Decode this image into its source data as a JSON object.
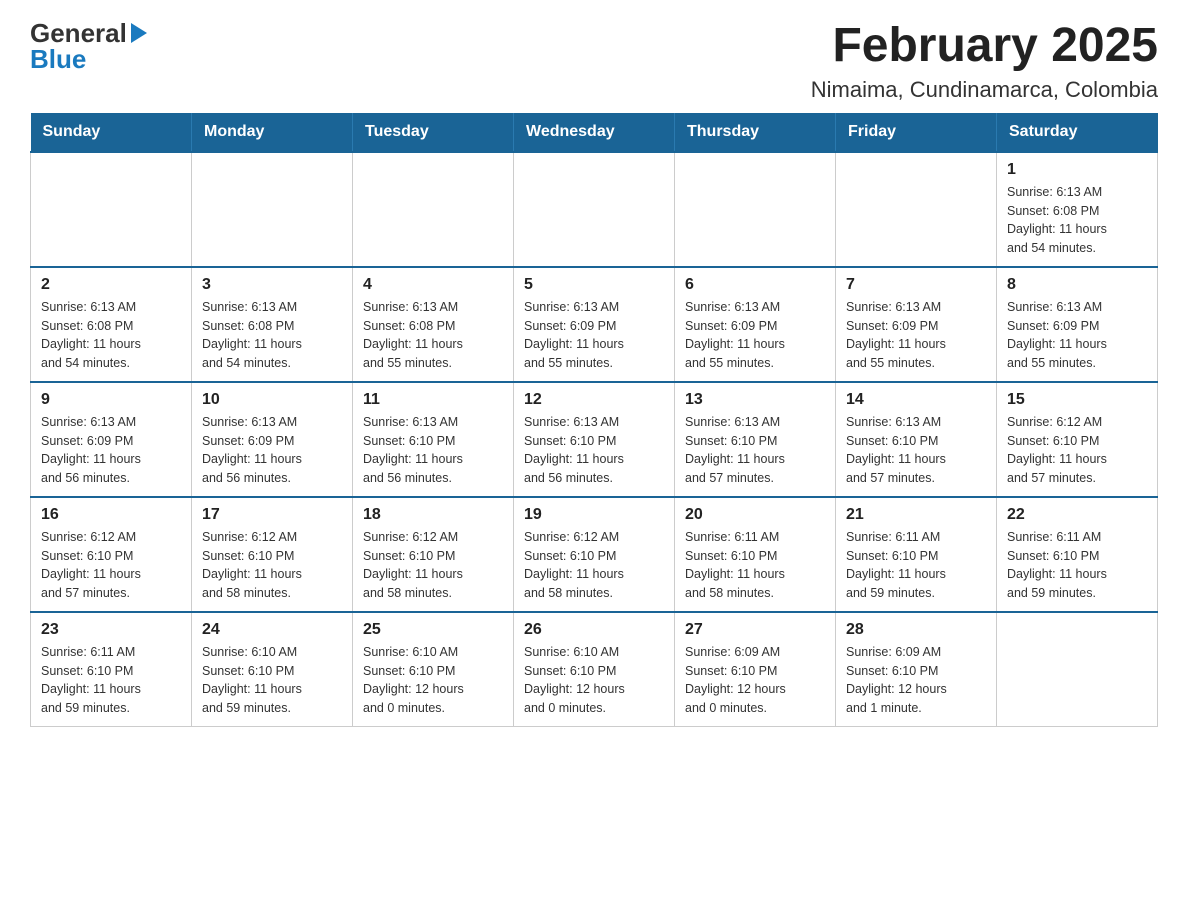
{
  "header": {
    "logo_general": "General",
    "logo_blue": "Blue",
    "title": "February 2025",
    "subtitle": "Nimaima, Cundinamarca, Colombia"
  },
  "weekdays": [
    "Sunday",
    "Monday",
    "Tuesday",
    "Wednesday",
    "Thursday",
    "Friday",
    "Saturday"
  ],
  "weeks": [
    [
      {
        "day": "",
        "info": ""
      },
      {
        "day": "",
        "info": ""
      },
      {
        "day": "",
        "info": ""
      },
      {
        "day": "",
        "info": ""
      },
      {
        "day": "",
        "info": ""
      },
      {
        "day": "",
        "info": ""
      },
      {
        "day": "1",
        "info": "Sunrise: 6:13 AM\nSunset: 6:08 PM\nDaylight: 11 hours\nand 54 minutes."
      }
    ],
    [
      {
        "day": "2",
        "info": "Sunrise: 6:13 AM\nSunset: 6:08 PM\nDaylight: 11 hours\nand 54 minutes."
      },
      {
        "day": "3",
        "info": "Sunrise: 6:13 AM\nSunset: 6:08 PM\nDaylight: 11 hours\nand 54 minutes."
      },
      {
        "day": "4",
        "info": "Sunrise: 6:13 AM\nSunset: 6:08 PM\nDaylight: 11 hours\nand 55 minutes."
      },
      {
        "day": "5",
        "info": "Sunrise: 6:13 AM\nSunset: 6:09 PM\nDaylight: 11 hours\nand 55 minutes."
      },
      {
        "day": "6",
        "info": "Sunrise: 6:13 AM\nSunset: 6:09 PM\nDaylight: 11 hours\nand 55 minutes."
      },
      {
        "day": "7",
        "info": "Sunrise: 6:13 AM\nSunset: 6:09 PM\nDaylight: 11 hours\nand 55 minutes."
      },
      {
        "day": "8",
        "info": "Sunrise: 6:13 AM\nSunset: 6:09 PM\nDaylight: 11 hours\nand 55 minutes."
      }
    ],
    [
      {
        "day": "9",
        "info": "Sunrise: 6:13 AM\nSunset: 6:09 PM\nDaylight: 11 hours\nand 56 minutes."
      },
      {
        "day": "10",
        "info": "Sunrise: 6:13 AM\nSunset: 6:09 PM\nDaylight: 11 hours\nand 56 minutes."
      },
      {
        "day": "11",
        "info": "Sunrise: 6:13 AM\nSunset: 6:10 PM\nDaylight: 11 hours\nand 56 minutes."
      },
      {
        "day": "12",
        "info": "Sunrise: 6:13 AM\nSunset: 6:10 PM\nDaylight: 11 hours\nand 56 minutes."
      },
      {
        "day": "13",
        "info": "Sunrise: 6:13 AM\nSunset: 6:10 PM\nDaylight: 11 hours\nand 57 minutes."
      },
      {
        "day": "14",
        "info": "Sunrise: 6:13 AM\nSunset: 6:10 PM\nDaylight: 11 hours\nand 57 minutes."
      },
      {
        "day": "15",
        "info": "Sunrise: 6:12 AM\nSunset: 6:10 PM\nDaylight: 11 hours\nand 57 minutes."
      }
    ],
    [
      {
        "day": "16",
        "info": "Sunrise: 6:12 AM\nSunset: 6:10 PM\nDaylight: 11 hours\nand 57 minutes."
      },
      {
        "day": "17",
        "info": "Sunrise: 6:12 AM\nSunset: 6:10 PM\nDaylight: 11 hours\nand 58 minutes."
      },
      {
        "day": "18",
        "info": "Sunrise: 6:12 AM\nSunset: 6:10 PM\nDaylight: 11 hours\nand 58 minutes."
      },
      {
        "day": "19",
        "info": "Sunrise: 6:12 AM\nSunset: 6:10 PM\nDaylight: 11 hours\nand 58 minutes."
      },
      {
        "day": "20",
        "info": "Sunrise: 6:11 AM\nSunset: 6:10 PM\nDaylight: 11 hours\nand 58 minutes."
      },
      {
        "day": "21",
        "info": "Sunrise: 6:11 AM\nSunset: 6:10 PM\nDaylight: 11 hours\nand 59 minutes."
      },
      {
        "day": "22",
        "info": "Sunrise: 6:11 AM\nSunset: 6:10 PM\nDaylight: 11 hours\nand 59 minutes."
      }
    ],
    [
      {
        "day": "23",
        "info": "Sunrise: 6:11 AM\nSunset: 6:10 PM\nDaylight: 11 hours\nand 59 minutes."
      },
      {
        "day": "24",
        "info": "Sunrise: 6:10 AM\nSunset: 6:10 PM\nDaylight: 11 hours\nand 59 minutes."
      },
      {
        "day": "25",
        "info": "Sunrise: 6:10 AM\nSunset: 6:10 PM\nDaylight: 12 hours\nand 0 minutes."
      },
      {
        "day": "26",
        "info": "Sunrise: 6:10 AM\nSunset: 6:10 PM\nDaylight: 12 hours\nand 0 minutes."
      },
      {
        "day": "27",
        "info": "Sunrise: 6:09 AM\nSunset: 6:10 PM\nDaylight: 12 hours\nand 0 minutes."
      },
      {
        "day": "28",
        "info": "Sunrise: 6:09 AM\nSunset: 6:10 PM\nDaylight: 12 hours\nand 1 minute."
      },
      {
        "day": "",
        "info": ""
      }
    ]
  ]
}
